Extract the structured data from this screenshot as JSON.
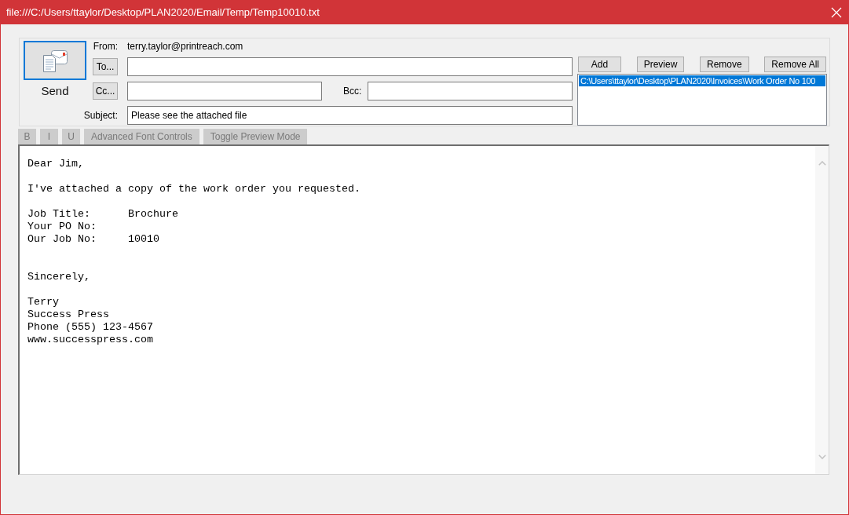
{
  "window": {
    "title": "file:///C:/Users/ttaylor/Desktop/PLAN2020/Email/Temp/Temp10010.txt"
  },
  "send_button": {
    "label": "Send",
    "focused": true
  },
  "from": {
    "label": "From:",
    "value": "terry.taylor@printreach.com"
  },
  "to": {
    "button": "To..."
  },
  "cc": {
    "button": "Cc..."
  },
  "bcc": {
    "label": "Bcc:"
  },
  "subject": {
    "label": "Subject:",
    "value": "Please see the attached file"
  },
  "attachment_buttons": [
    "Add",
    "Preview",
    "Remove",
    "Remove All"
  ],
  "attachments": [
    {
      "path": "C:\\Users\\ttaylor\\Desktop\\PLAN2020\\Invoices\\Work Order No 100",
      "selected": true
    }
  ],
  "format_toolbar": [
    {
      "label": "B",
      "disabled": true
    },
    {
      "label": "I",
      "disabled": true
    },
    {
      "label": "U",
      "disabled": true
    },
    {
      "label": "Advanced Font Controls",
      "disabled": true
    },
    {
      "label": "Toggle Preview Mode",
      "disabled": true
    }
  ],
  "message": {
    "greeting": "Dear Jim,",
    "intro": "I've attached a copy of the work order you requested.",
    "details": [
      {
        "label": "Job Title:",
        "value": "Brochure"
      },
      {
        "label": "Your PO No:"
      },
      {
        "label": "Our Job No:",
        "value": "10010"
      }
    ],
    "closing": "Sincerely,",
    "signature": [
      "Terry",
      "Success Press",
      "Phone (555) 123-4567",
      "www.successpress.com"
    ]
  }
}
